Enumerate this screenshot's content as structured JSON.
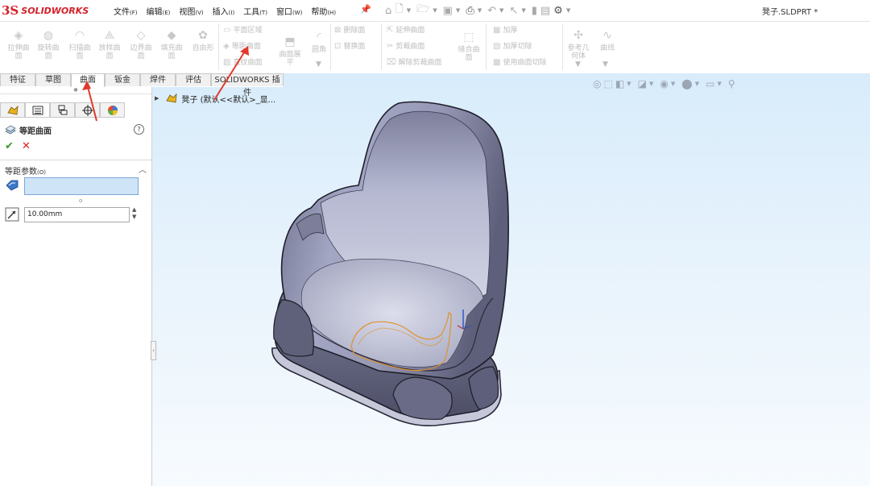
{
  "app": {
    "logo_prefix": "3S",
    "logo_name": "SOLIDWORKS",
    "document_title": "凳子.SLDPRT *"
  },
  "menu": [
    {
      "label": "文件",
      "key": "(F)"
    },
    {
      "label": "编辑",
      "key": "(E)"
    },
    {
      "label": "视图",
      "key": "(V)"
    },
    {
      "label": "插入",
      "key": "(I)"
    },
    {
      "label": "工具",
      "key": "(T)"
    },
    {
      "label": "窗口",
      "key": "(W)"
    },
    {
      "label": "帮助",
      "key": "(H)"
    }
  ],
  "ribbon": {
    "large": [
      {
        "l1": "拉伸曲",
        "l2": "面"
      },
      {
        "l1": "旋转曲",
        "l2": "面"
      },
      {
        "l1": "扫描曲",
        "l2": "面"
      },
      {
        "l1": "放样曲",
        "l2": "面"
      },
      {
        "l1": "边界曲",
        "l2": "面"
      },
      {
        "l1": "填充曲",
        "l2": "面"
      },
      {
        "l1": "自由形",
        "l2": ""
      }
    ],
    "g2": [
      "平面区域",
      "等距曲面",
      "直纹曲面"
    ],
    "surface_flatten": {
      "l1": "曲面展",
      "l2": "平"
    },
    "fillet": "圆角",
    "g3": [
      "删除面",
      "替换面"
    ],
    "g4": [
      "延伸曲面",
      "剪裁曲面",
      "解除剪裁曲面"
    ],
    "knit": {
      "l1": "缝合曲",
      "l2": "面"
    },
    "g5": [
      "加厚",
      "加厚切除",
      "使用曲面切除"
    ],
    "ref_geometry": {
      "l1": "参考几",
      "l2": "何体"
    },
    "curves": "曲线"
  },
  "tabs": [
    "特征",
    "草图",
    "曲面",
    "钣金",
    "焊件",
    "评估",
    "SOLIDWORKS 插件"
  ],
  "panel": {
    "feature_title": "等距曲面",
    "help": "?",
    "ok": "✔",
    "cancel": "✕",
    "group_title": "等距参数",
    "group_key": "(O)",
    "distance": "10.00mm"
  },
  "tree": {
    "part_label": "凳子 (默认<<默认>_显..."
  },
  "colors": {
    "accent": "#2a6ac8",
    "logo": "#d4202a",
    "annotation_arrow": "#e03a2c",
    "selection_curve": "#e0922e"
  }
}
